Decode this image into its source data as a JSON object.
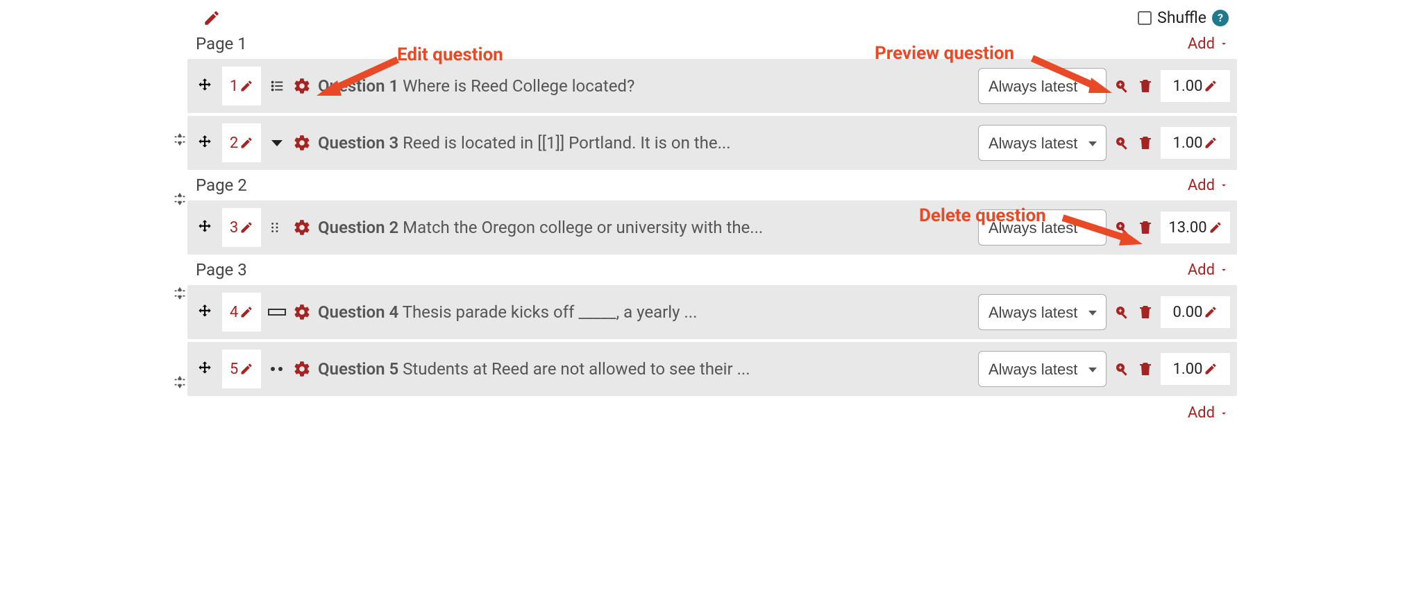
{
  "toolbar": {
    "shuffle_label": "Shuffle",
    "help_text": "?"
  },
  "annotations": {
    "edit": "Edit question",
    "preview": "Preview question",
    "delete": "Delete question"
  },
  "add_label": "Add",
  "pages": [
    {
      "title": "Page 1",
      "questions": [
        {
          "num": "1",
          "label": "Question 1",
          "text": " Where is Reed College located?",
          "version": "Always latest",
          "mark": "1.00",
          "type": "choice"
        },
        {
          "num": "2",
          "label": "Question 3",
          "text": " Reed is located in [[1]] Portland. It is on the...",
          "version": "Always latest",
          "mark": "1.00",
          "type": "dropdown"
        }
      ]
    },
    {
      "title": "Page 2",
      "questions": [
        {
          "num": "3",
          "label": "Question 2",
          "text": " Match the Oregon college or university with the...",
          "version": "Always latest",
          "mark": "13.00",
          "type": "match"
        }
      ]
    },
    {
      "title": "Page 3",
      "questions": [
        {
          "num": "4",
          "label": "Question 4",
          "text": " Thesis parade kicks off _____, a yearly ...",
          "version": "Always latest",
          "mark": "0.00",
          "type": "gap"
        },
        {
          "num": "5",
          "label": "Question 5",
          "text": " Students at Reed are not allowed to see their ...",
          "version": "Always latest",
          "mark": "1.00",
          "type": "tf"
        }
      ]
    }
  ],
  "icons": {
    "pencil": "pencil-icon",
    "move": "move-icon",
    "gear": "gear-icon",
    "preview": "preview-icon",
    "trash": "trash-icon"
  }
}
